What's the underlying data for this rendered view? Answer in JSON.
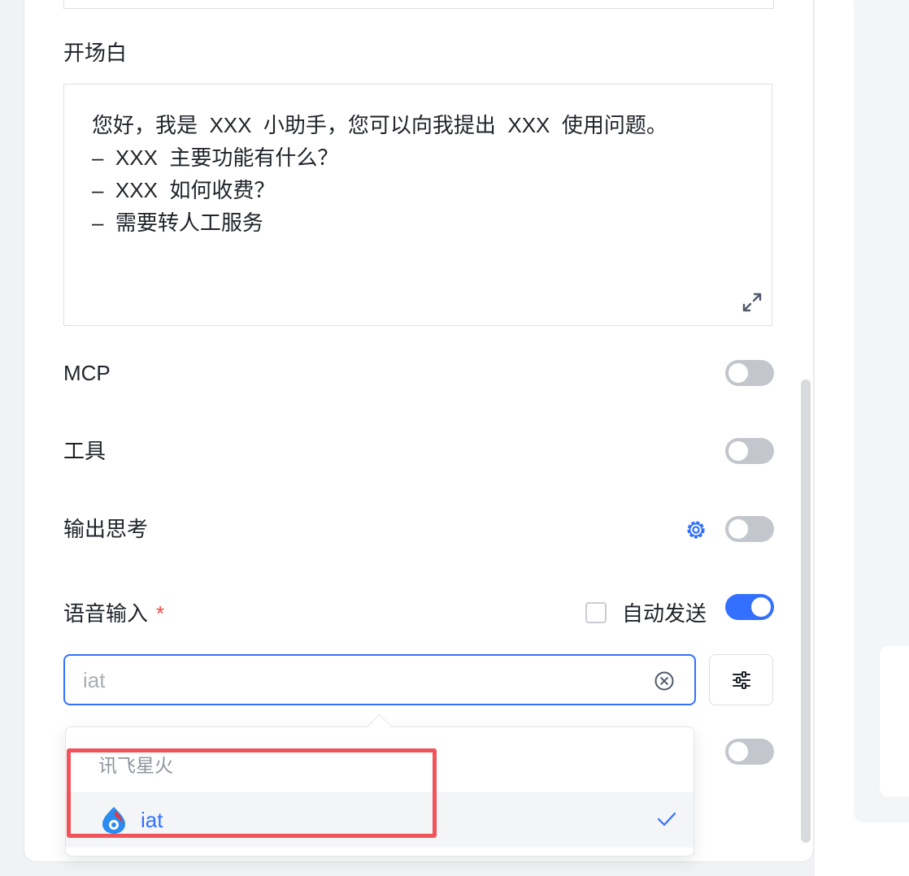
{
  "opening": {
    "label": "开场白",
    "lines": [
      "您好，我是  XXX  小助手，您可以向我提出  XXX  使用问题。",
      "–  XXX  主要功能有什么？",
      "–  XXX  如何收费？",
      "–  需要转人工服务"
    ],
    "expand_icon": "expand-arrows-icon"
  },
  "settings": {
    "mcp": {
      "label": "MCP",
      "enabled": false
    },
    "tools": {
      "label": "工具",
      "enabled": false
    },
    "reasoning_output": {
      "label": "输出思考",
      "enabled": false,
      "icon": "gear-icon"
    },
    "voice_input": {
      "label": "语音输入",
      "required_mark": "*",
      "enabled": true,
      "auto_send": {
        "label": "自动发送",
        "checked": false
      }
    },
    "hidden_row": {
      "enabled": false
    }
  },
  "model_select": {
    "placeholder": "iat",
    "value": "",
    "clear_icon": "clear-circle-icon",
    "settings_icon": "sliders-icon"
  },
  "dropdown": {
    "groups": [
      {
        "title": "讯飞星火",
        "options": [
          {
            "label": "iat",
            "selected": true,
            "icon": "iflytek-spark-logo"
          }
        ]
      }
    ]
  },
  "colors": {
    "accent": "#3370ff",
    "toggle_off": "#c3c6cc",
    "required": "#f54a45",
    "highlight": "#f0545a"
  }
}
